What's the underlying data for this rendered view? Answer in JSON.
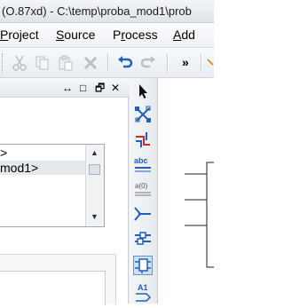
{
  "window": {
    "title": "(O.87xd) - C:\\temp\\proba_mod1\\prob"
  },
  "menu": {
    "items": [
      {
        "label": "Project",
        "underline": "P"
      },
      {
        "label": "Source",
        "underline": "S"
      },
      {
        "label": "Process",
        "underline": "r"
      },
      {
        "label": "Add",
        "underline": "A"
      }
    ]
  },
  "toolbar": {
    "buttons": [
      "cut-icon",
      "copy-icon",
      "paste-icon",
      "delete-icon",
      "undo-icon",
      "redo-icon"
    ],
    "overflow_label": "»"
  },
  "panel": {
    "header_buttons": [
      "↔",
      "□",
      "🗗",
      "✕"
    ],
    "list_items": [
      ">",
      "mod1>"
    ]
  },
  "palette": {
    "tools": [
      "select-pointer-icon",
      "add-net-icon",
      "add-wire-icon",
      "add-net-name-icon",
      "rename-bus-icon",
      "add-io-marker-icon",
      "add-symbol-icon",
      "add-instance-icon",
      "add-text-icon"
    ],
    "labels": {
      "abc": "abc",
      "a0": "a(0)",
      "a1": "A1"
    }
  },
  "colors": {
    "accent_blue": "#1f5fbf",
    "accent_red": "#d62828",
    "accent_green": "#2d8a2d",
    "active_tool_bg": "#cfe0f3"
  }
}
